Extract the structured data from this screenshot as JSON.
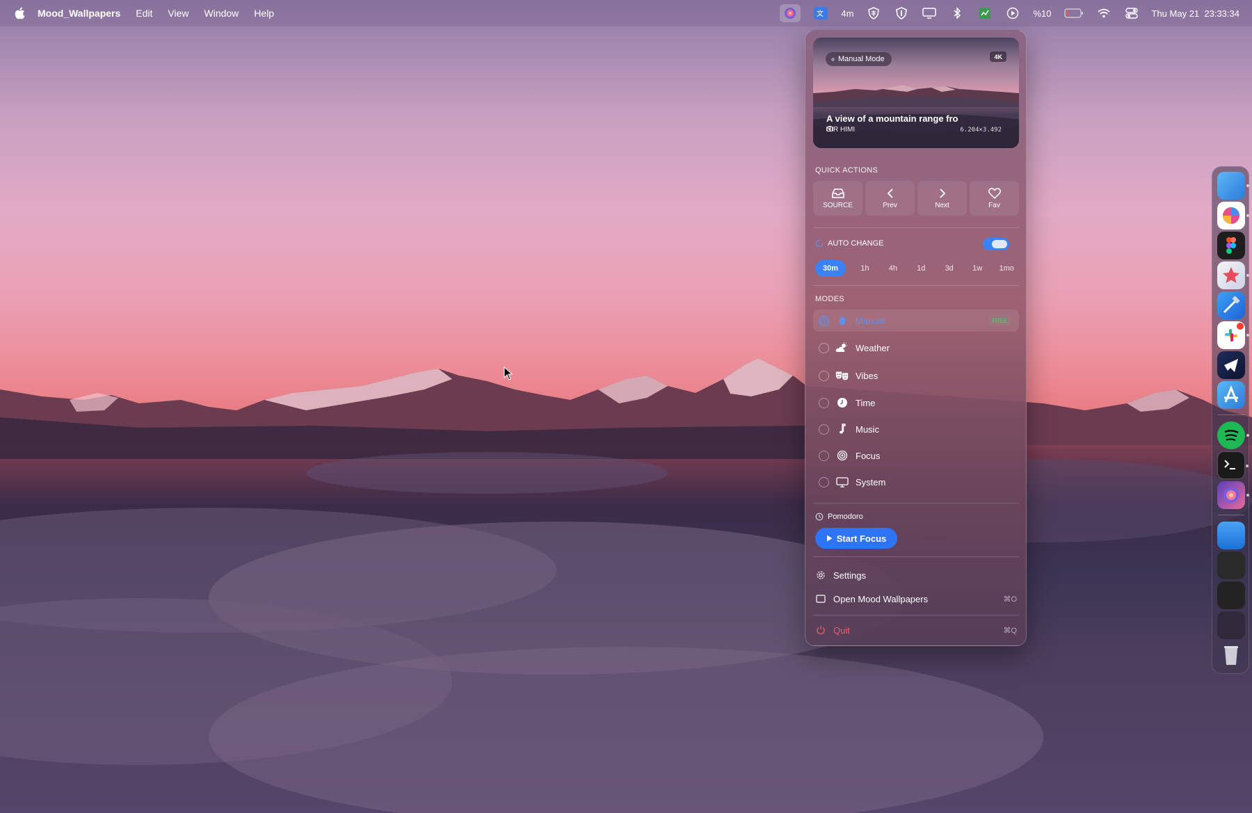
{
  "menubar": {
    "app_name": "Mood_Wallpapers",
    "menus": [
      "Edit",
      "View",
      "Window",
      "Help"
    ],
    "timer_text": "4m",
    "battery_text": "%10",
    "clock": "Thu May 21  23:33:34"
  },
  "popover": {
    "preview": {
      "mode_badge": "Manual Mode",
      "quality_badge": "4K",
      "title": "A view of a mountain range fro",
      "author": "NIR HIMI",
      "resolution": "6.204×3.492"
    },
    "quick_actions": {
      "label": "QUICK ACTIONS",
      "buttons": [
        {
          "label": "SOURCE",
          "icon": "tray-icon"
        },
        {
          "label": "Prev",
          "icon": "chevron-left-icon"
        },
        {
          "label": "Next",
          "icon": "chevron-right-icon"
        },
        {
          "label": "Fav",
          "icon": "heart-icon"
        }
      ]
    },
    "auto_change": {
      "label": "AUTO CHANGE",
      "enabled": true,
      "intervals": [
        "30m",
        "1h",
        "4h",
        "1d",
        "3d",
        "1w",
        "1mo"
      ],
      "selected": "30m"
    },
    "modes": {
      "label": "MODES",
      "items": [
        {
          "label": "Manual",
          "icon": "hand-icon",
          "tag": "FREE"
        },
        {
          "label": "Weather",
          "icon": "cloud-sun-icon"
        },
        {
          "label": "Vibes",
          "icon": "masks-icon"
        },
        {
          "label": "Time",
          "icon": "clock-icon"
        },
        {
          "label": "Music",
          "icon": "music-note-icon"
        },
        {
          "label": "Focus",
          "icon": "target-icon"
        },
        {
          "label": "System",
          "icon": "monitor-icon"
        }
      ]
    },
    "pomodoro": {
      "label": "Pomodoro",
      "button": "Start Focus"
    },
    "menu": {
      "settings": "Settings",
      "open": "Open Mood Wallpapers",
      "open_shortcut": "⌘O",
      "quit": "Quit",
      "quit_shortcut": "⌘Q"
    }
  },
  "colors": {
    "accent": "#3b82f6",
    "quit": "#f05c6a",
    "free": "#5fb96d"
  }
}
